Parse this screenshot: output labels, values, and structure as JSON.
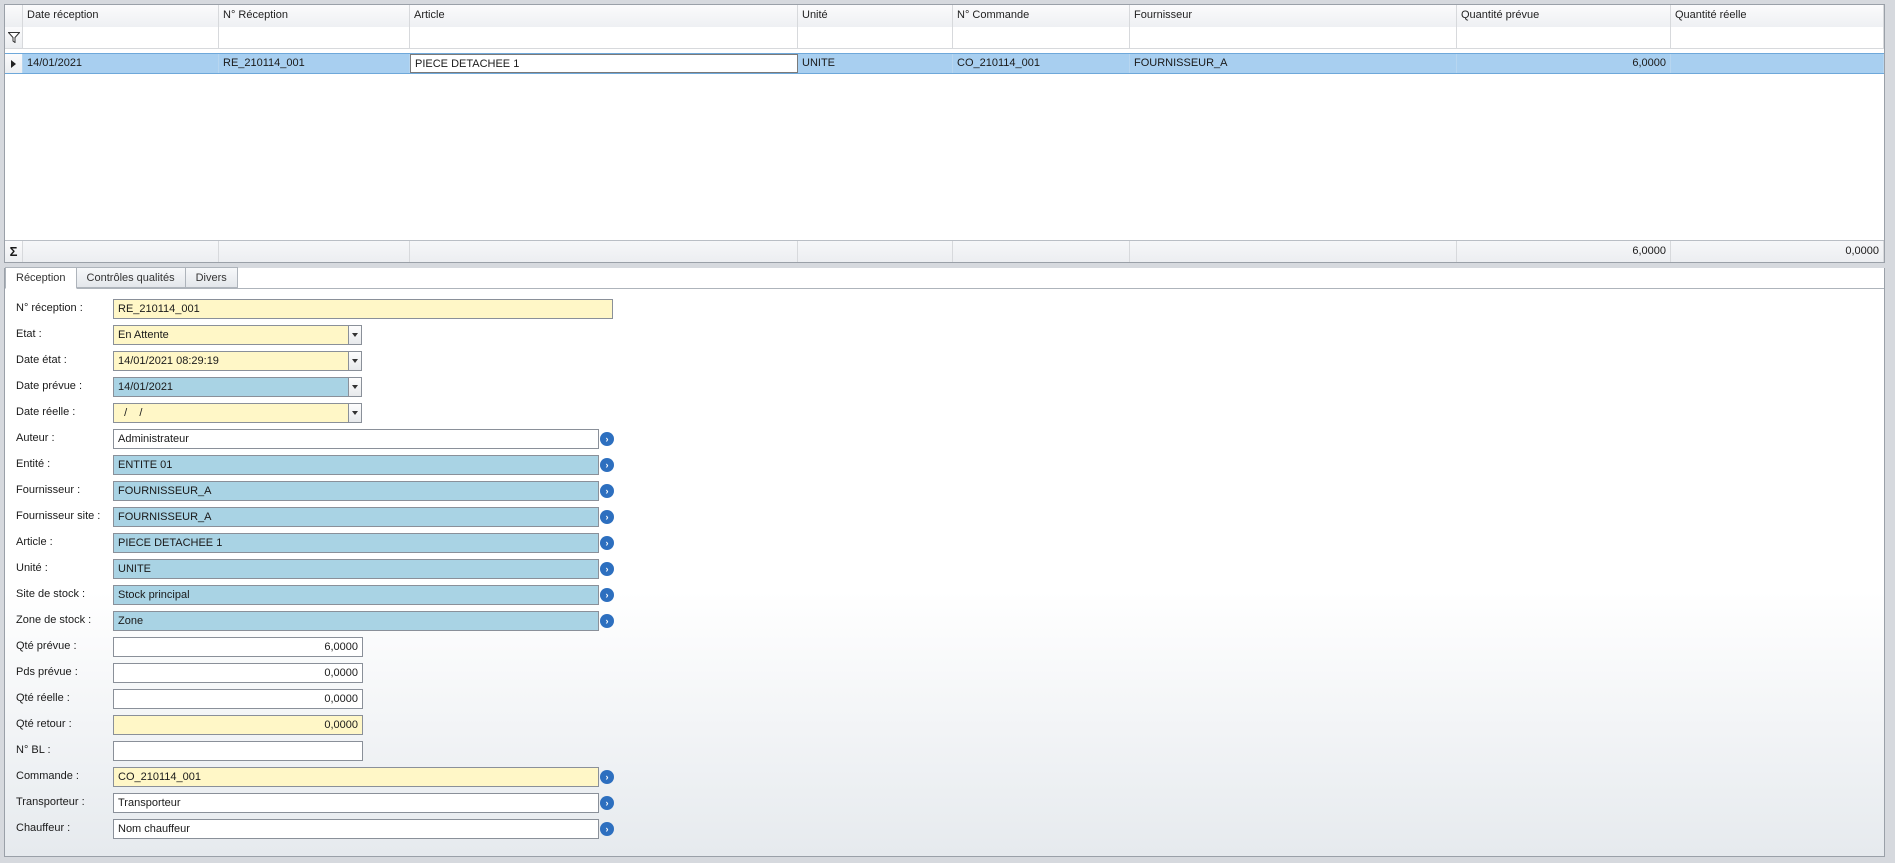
{
  "grid": {
    "columns": [
      "Date réception",
      "N° Réception",
      "Article",
      "Unité",
      "N° Commande",
      "Fournisseur",
      "Quantité prévue",
      "Quantité réelle"
    ],
    "row": {
      "date": "14/01/2021",
      "reception": "RE_210114_001",
      "article": "PIECE DETACHEE 1",
      "unite": "UNITE",
      "commande": "CO_210114_001",
      "fournisseur": "FOURNISSEUR_A",
      "qte_prevue": "6,0000",
      "qte_reelle": ""
    },
    "totals": {
      "qte_prevue": "6,0000",
      "qte_reelle": "0,0000"
    },
    "filter_icon": "filter-icon",
    "sum_icon": "sigma-icon"
  },
  "tabs": [
    "Réception",
    "Contrôles qualités",
    "Divers"
  ],
  "form": {
    "n_reception": {
      "label": "N° réception :",
      "value": "RE_210114_001"
    },
    "etat": {
      "label": "Etat :",
      "value": "En Attente"
    },
    "date_etat": {
      "label": "Date état :",
      "value": "14/01/2021 08:29:19"
    },
    "date_prevue": {
      "label": "Date  prévue :",
      "value": "14/01/2021"
    },
    "date_reelle": {
      "label": "Date réelle :",
      "value": "  /    /"
    },
    "auteur": {
      "label": "Auteur :",
      "value": "Administrateur"
    },
    "entite": {
      "label": "Entité :",
      "value": "ENTITE 01"
    },
    "fournisseur": {
      "label": "Fournisseur :",
      "value": "FOURNISSEUR_A"
    },
    "fournisseur_site": {
      "label": "Fournisseur site :",
      "value": "FOURNISSEUR_A"
    },
    "article": {
      "label": "Article :",
      "value": "PIECE DETACHEE 1"
    },
    "unite": {
      "label": "Unité :",
      "value": "UNITE"
    },
    "site_stock": {
      "label": "Site de stock :",
      "value": "Stock principal"
    },
    "zone_stock": {
      "label": "Zone de stock :",
      "value": "Zone"
    },
    "qte_prevue": {
      "label": "Qté prévue :",
      "value": "6,0000"
    },
    "pds_prevue": {
      "label": "Pds prévue :",
      "value": "0,0000"
    },
    "qte_reelle": {
      "label": "Qté réelle :",
      "value": "0,0000"
    },
    "qte_retour": {
      "label": "Qté retour :",
      "value": "0,0000"
    },
    "n_bl": {
      "label": "N° BL :",
      "value": ""
    },
    "commande": {
      "label": "Commande :",
      "value": "CO_210114_001"
    },
    "transporteur": {
      "label": "Transporteur :",
      "value": "Transporteur"
    },
    "chauffeur": {
      "label": "Chauffeur :",
      "value": "Nom chauffeur"
    }
  },
  "colors": {
    "selected_row": "#a8cff0",
    "required_field": "#fff7c7",
    "readonly_field": "#a9d3e4",
    "lookup_button": "#2d6fbf"
  }
}
